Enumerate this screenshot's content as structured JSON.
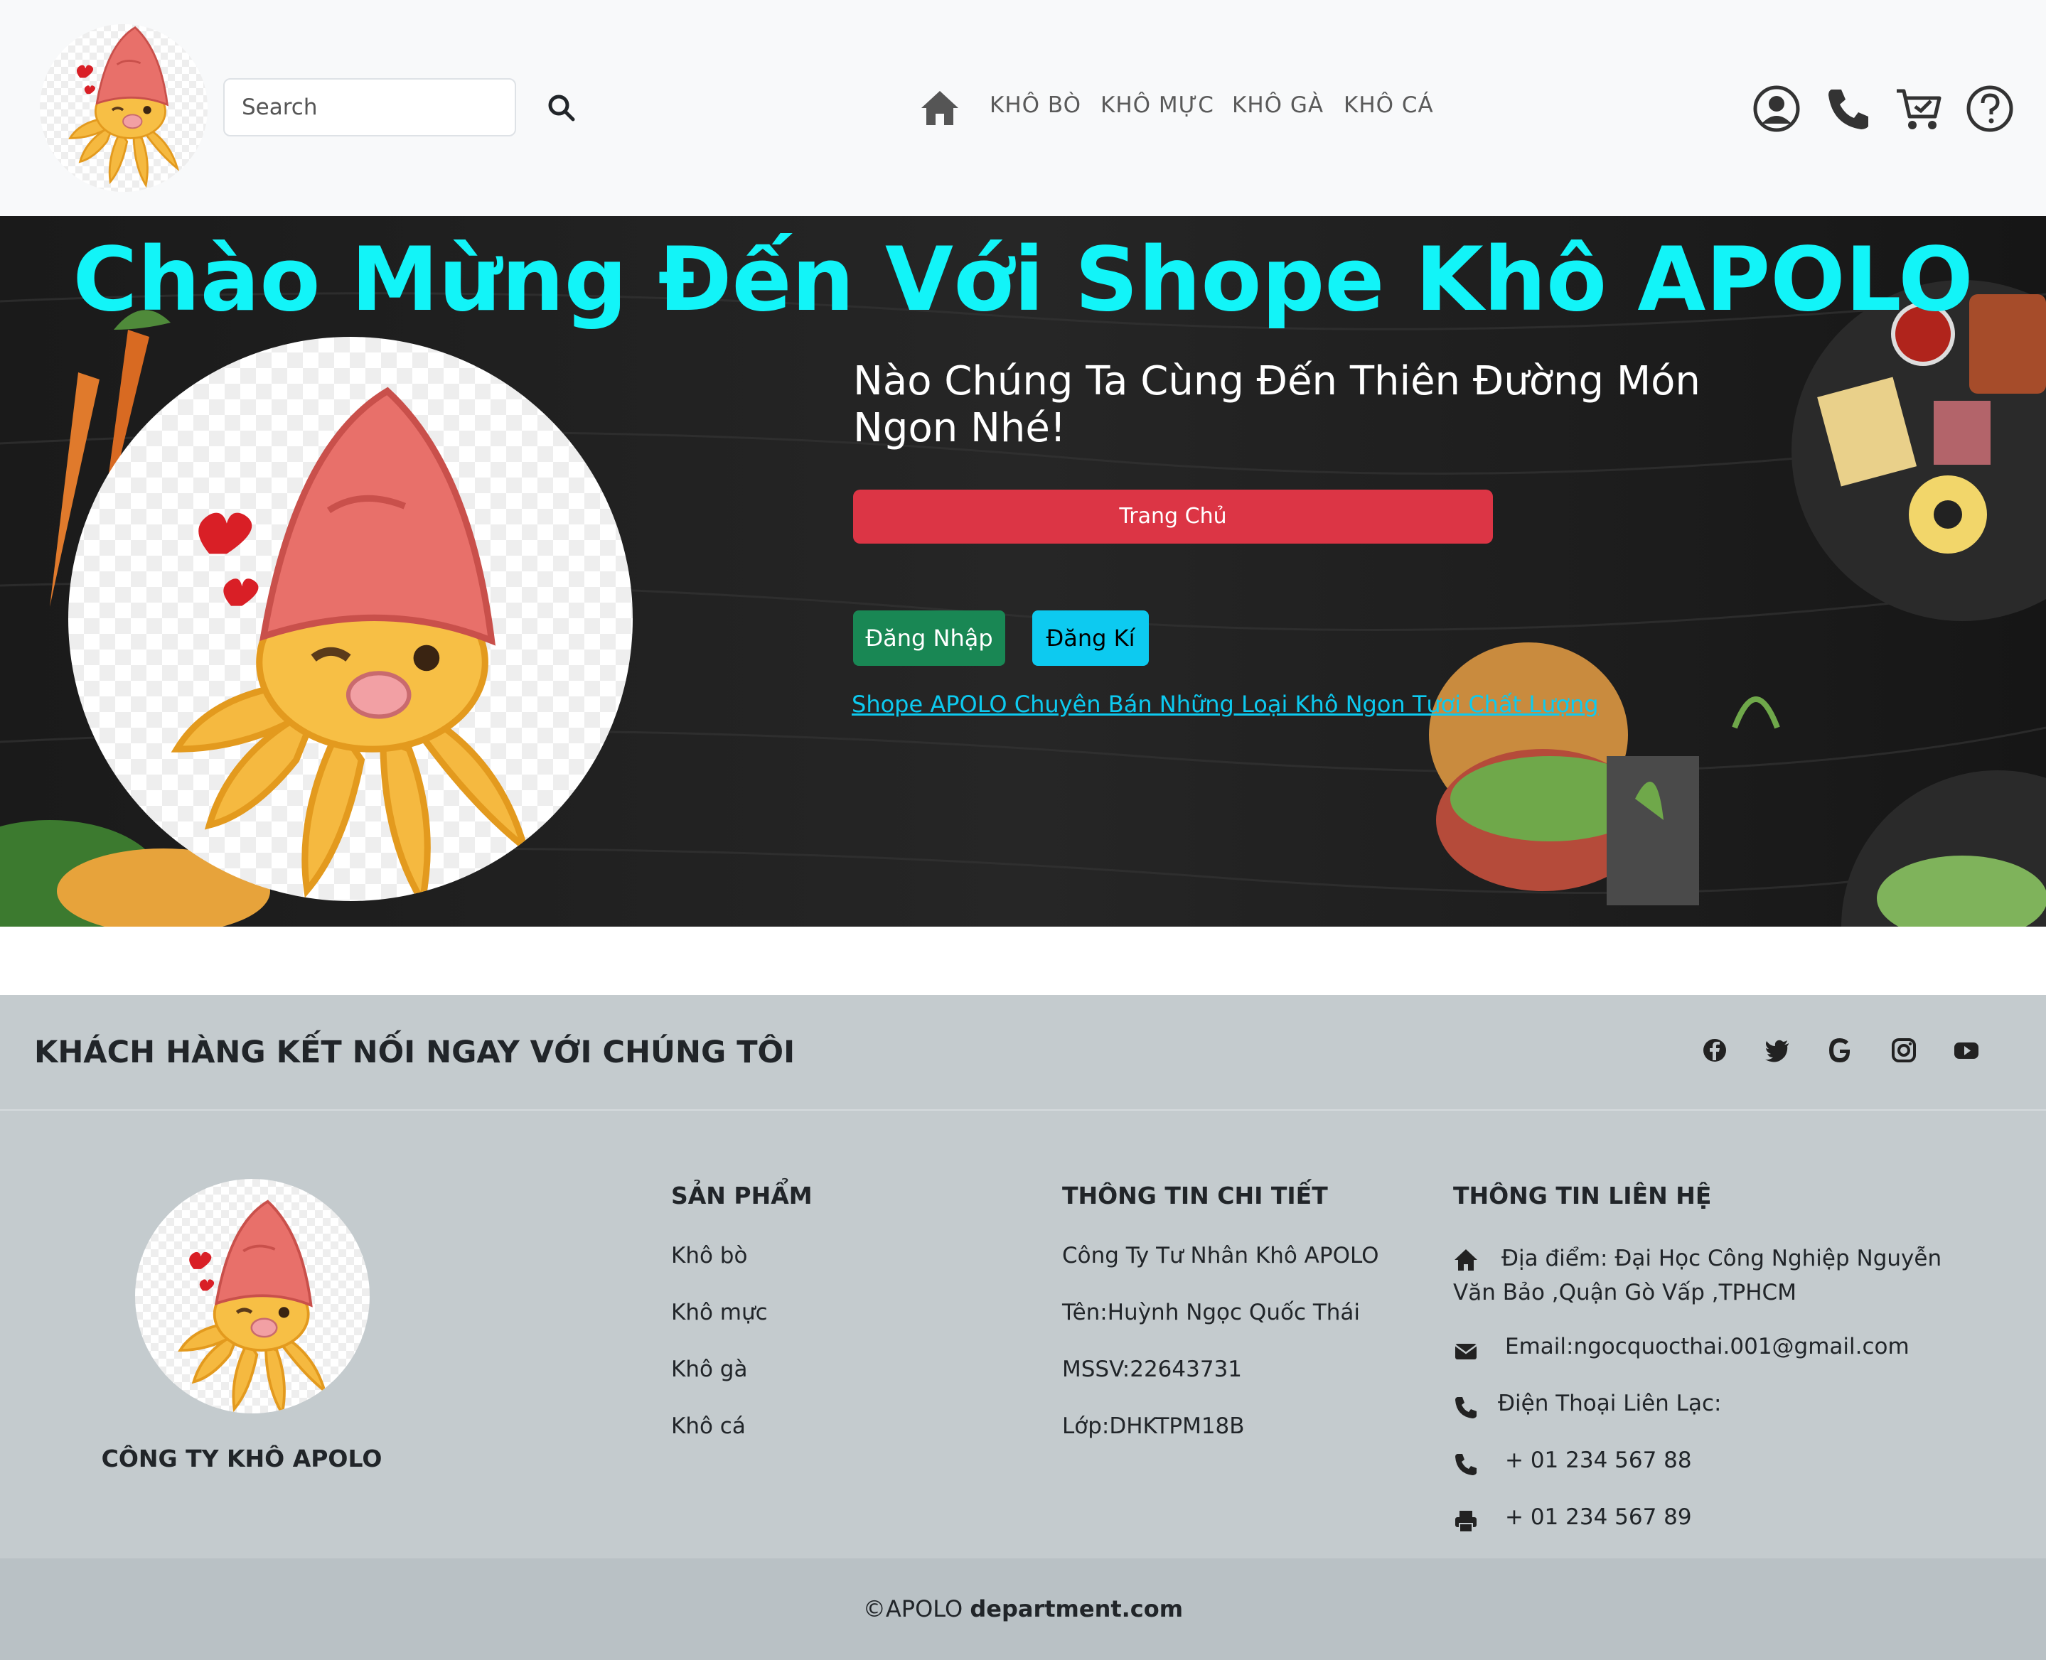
{
  "header": {
    "search_placeholder": "Search",
    "nav": [
      "KHÔ BÒ",
      "KHÔ MỰC",
      "KHÔ GÀ",
      "KHÔ CÁ"
    ]
  },
  "hero": {
    "title": "Chào Mừng Đến Với Shope Khô APOLO",
    "subtitle": "Nào Chúng Ta Cùng Đến Thiên Đường Món Ngon Nhé!",
    "home_button": "Trang Chủ",
    "login_button": "Đăng Nhập",
    "register_button": "Đăng Kí",
    "link": "Shope APOLO Chuyên Bán Những Loại Khô Ngon Tươi Chất Lượng"
  },
  "social": {
    "title": "KHÁCH HÀNG KẾT NỐI NGAY VỚI CHÚNG TÔI",
    "icons": [
      "facebook-icon",
      "twitter-icon",
      "google-icon",
      "instagram-icon",
      "youtube-icon"
    ]
  },
  "footer": {
    "company": "CÔNG TY KHÔ APOLO",
    "products": {
      "heading": "SẢN PHẨM",
      "items": [
        "Khô bò",
        "Khô mực",
        "Khô gà",
        "Khô cá"
      ]
    },
    "details": {
      "heading": "THÔNG TIN CHI TIẾT",
      "items": [
        "Công Ty Tư Nhân Khô APOLO",
        "Tên:Huỳnh Ngọc Quốc Thái",
        "MSSV:22643731",
        "Lớp:DHKTPM18B"
      ]
    },
    "contact": {
      "heading": "THÔNG TIN LIÊN HỆ",
      "address": "Địa điểm: Đại Học Công Nghiệp Nguyễn Văn Bảo ,Quận Gò Vấp ,TPHCM",
      "email": "Email:ngocquocthai.001@gmail.com",
      "phone_label": "Điện Thoại Liên Lạc:",
      "phone": "+ 01 234 567 88",
      "fax": "+ 01 234 567 89"
    }
  },
  "copyright": {
    "prefix": "©APOLO",
    "domain": "department.com"
  },
  "colors": {
    "hero_title": "#12f4f8",
    "danger": "#dc3545",
    "success": "#198754",
    "info": "#0dcaf0",
    "footer_bg": "#c4cbce"
  }
}
